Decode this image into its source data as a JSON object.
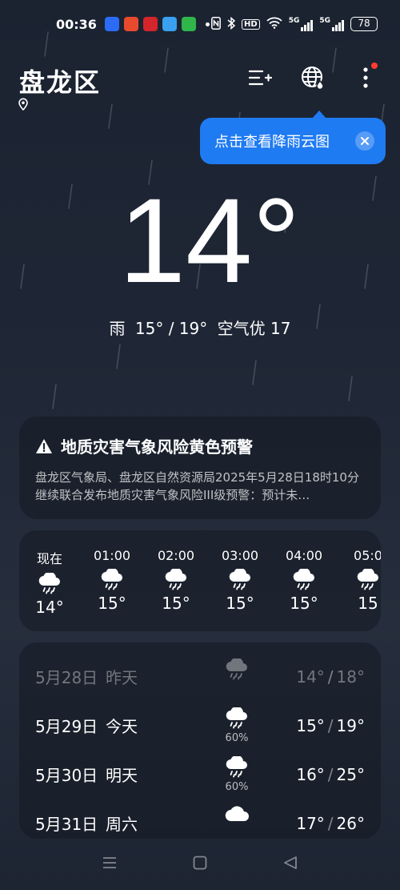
{
  "status_bar": {
    "time": "00:36",
    "battery": "78",
    "net_5g_1": "5G",
    "net_5g_2": "5G",
    "hd": "HD"
  },
  "header": {
    "city": "盘龙区"
  },
  "tooltip": {
    "text": "点击查看降雨云图"
  },
  "current": {
    "temperature": "14°",
    "condition": "雨",
    "range": "15° / 19°",
    "air_quality": "空气优 17"
  },
  "alert": {
    "title": "地质灾害气象风险黄色预警",
    "body": "盘龙区气象局、盘龙区自然资源局2025年5月28日18时10分继续联合发布地质灾害气象风险III级预警：预计未…"
  },
  "hourly": [
    {
      "time": "现在",
      "temp": "14°",
      "icon": "rain-icon"
    },
    {
      "time": "01:00",
      "temp": "15°",
      "icon": "rain-icon"
    },
    {
      "time": "02:00",
      "temp": "15°",
      "icon": "rain-icon"
    },
    {
      "time": "03:00",
      "temp": "15°",
      "icon": "rain-icon"
    },
    {
      "time": "04:00",
      "temp": "15°",
      "icon": "rain-icon"
    },
    {
      "time": "05:0",
      "temp": "15",
      "icon": "rain-icon"
    }
  ],
  "daily": [
    {
      "date": "5月28日",
      "label": "昨天",
      "icon": "rain-icon",
      "prob": "",
      "low": "14°",
      "high": "18°"
    },
    {
      "date": "5月29日",
      "label": "今天",
      "icon": "rain-icon",
      "prob": "60%",
      "low": "15°",
      "high": "19°"
    },
    {
      "date": "5月30日",
      "label": "明天",
      "icon": "rain-icon",
      "prob": "60%",
      "low": "16°",
      "high": "25°"
    },
    {
      "date": "5月31日",
      "label": "周六",
      "icon": "cloud-icon",
      "prob": "",
      "low": "17°",
      "high": "26°"
    }
  ],
  "colors": {
    "accent": "#1f7bf2",
    "badge": "#ff3b30"
  }
}
